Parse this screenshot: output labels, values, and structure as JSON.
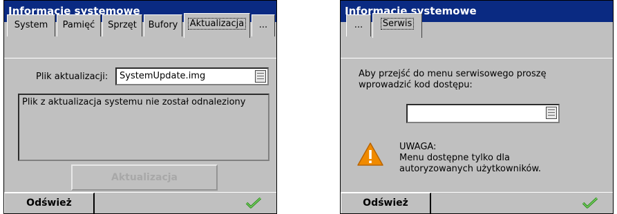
{
  "left_window": {
    "title": "Informacje systemowe",
    "tabs": [
      "System",
      "Pamięć",
      "Sprzęt",
      "Bufory",
      "Aktualizacja",
      "..."
    ],
    "active_tab": "Aktualizacja",
    "file_label": "Plik aktualizacji:",
    "file_value": "SystemUpdate.img",
    "message": "Plik z aktualizacja systemu nie został odnaleziony",
    "update_button": "Aktualizacja",
    "refresh_button": "Odśwież"
  },
  "right_window": {
    "title": "Informacje systemowe",
    "tabs": [
      "...",
      "Serwis"
    ],
    "active_tab": "Serwis",
    "prompt": "Aby przejść do menu serwisowego proszę wprowadzić kod dostępu:",
    "code_value": "",
    "warning_title": "UWAGA:",
    "warning_line1": "Menu dostępne tylko dla",
    "warning_line2": "autoryzowanych użytkowników.",
    "refresh_button": "Odśwież"
  },
  "colors": {
    "titlebar": "#0a2a82",
    "check": "#2f8f1f",
    "warning": "#f08a00"
  },
  "icons": {
    "ok": "check-icon",
    "warn": "warning-icon",
    "picker": "file-picker-icon"
  }
}
